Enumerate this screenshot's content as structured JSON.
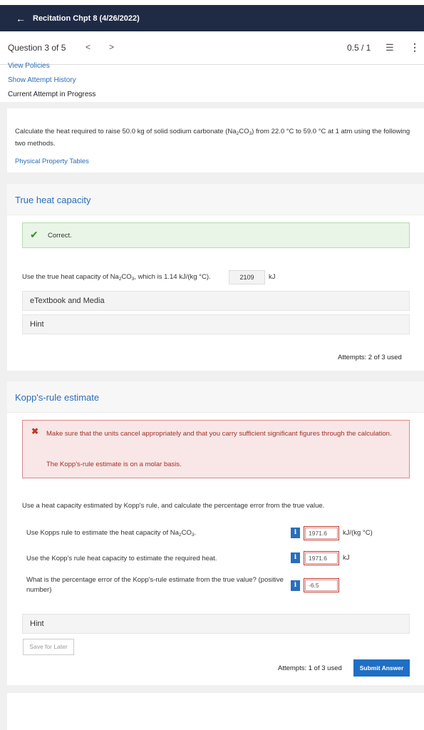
{
  "header": {
    "back_icon": "arrow-left-icon",
    "title": "Recitation Chpt 8 (4/26/2022)"
  },
  "question_bar": {
    "question_label": "Question 3 of 5",
    "prev": "<",
    "next": ">",
    "score": "0.5 / 1",
    "list_icon": "list-icon",
    "more_icon": "kebab-menu-icon"
  },
  "links": {
    "view_policies": "View Policies",
    "show_attempt_history": "Show Attempt History",
    "current_attempt": "Current Attempt in Progress"
  },
  "problem": {
    "text_before": "Calculate the heat required to raise 50.0 kg of solid sodium carbonate (Na",
    "sub2": "2",
    "text_mid": "CO",
    "sub3": "3",
    "text_after": ") from 22.0 °C to 59.0 °C at 1 atm using the following two methods.",
    "tables_link": "Physical Property Tables"
  },
  "part1": {
    "title": "True heat capacity",
    "feedback": "Correct.",
    "question_before": "Use the true heat capacity of Na",
    "question_sub2": "2",
    "question_mid": "CO",
    "question_sub3": "3",
    "question_after": ", which is 1.14 kJ/(kg °C).",
    "answer": "2109",
    "unit": "kJ",
    "etextbook": "eTextbook and Media",
    "hint": "Hint",
    "attempts": "Attempts: 2 of 3 used"
  },
  "part2": {
    "title": "Kopp's-rule estimate",
    "error_message": "Make sure that the units cancel appropriately and that you carry sufficient significant figures through the calculation.",
    "error_note": "The Kopp's-rule estimate is on a molar basis.",
    "intro": "Use a heat capacity estimated by Kopp's rule, and calculate the percentage error from the true value.",
    "q1_before": "Use Kopps rule to estimate the heat capacity of Na",
    "q1_sub2": "2",
    "q1_mid": "CO",
    "q1_sub3": "3",
    "q1_after": ".",
    "q1_value": "1971.6",
    "q1_unit": "kJ/(kg °C)",
    "q2": "Use the Kopp's rule heat capacity to estimate the required heat.",
    "q2_value": "1971.6",
    "q2_unit": "kJ",
    "q3": "What is the percentage error of the Kopp's-rule estimate from the true value? (positive number)",
    "q3_value": "-6.5",
    "info_glyph": "i",
    "hint": "Hint",
    "save_label": "Save for Later",
    "attempts": "Attempts: 1 of 3 used",
    "submit_label": "Submit Answer"
  }
}
